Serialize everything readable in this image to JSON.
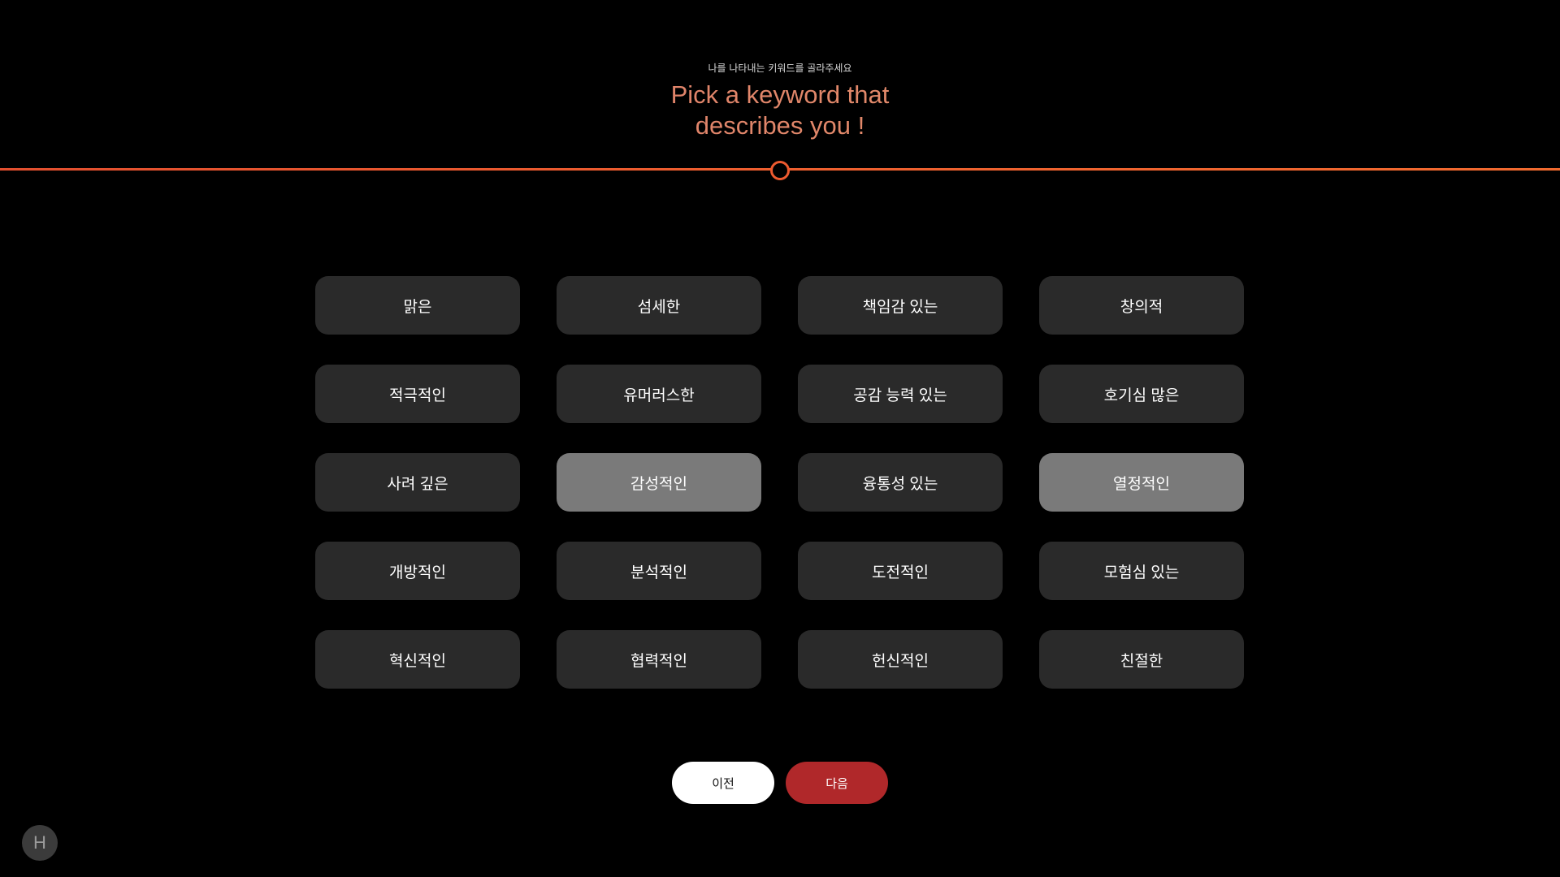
{
  "header": {
    "subtitle": "나를 나타내는 키워드를 골라주세요",
    "title_line1": "Pick a keyword that",
    "title_line2": "describes you !"
  },
  "keywords": [
    {
      "label": "맑은",
      "selected": false
    },
    {
      "label": "섬세한",
      "selected": false
    },
    {
      "label": "책임감 있는",
      "selected": false
    },
    {
      "label": "창의적",
      "selected": false
    },
    {
      "label": "적극적인",
      "selected": false
    },
    {
      "label": "유머러스한",
      "selected": false
    },
    {
      "label": "공감 능력 있는",
      "selected": false
    },
    {
      "label": "호기심 많은",
      "selected": false
    },
    {
      "label": "사려 깊은",
      "selected": false
    },
    {
      "label": "감성적인",
      "selected": true
    },
    {
      "label": "융통성 있는",
      "selected": false
    },
    {
      "label": "열정적인",
      "selected": true
    },
    {
      "label": "개방적인",
      "selected": false
    },
    {
      "label": "분석적인",
      "selected": false
    },
    {
      "label": "도전적인",
      "selected": false
    },
    {
      "label": "모험심 있는",
      "selected": false
    },
    {
      "label": "혁신적인",
      "selected": false
    },
    {
      "label": "협력적인",
      "selected": false
    },
    {
      "label": "헌신적인",
      "selected": false
    },
    {
      "label": "친절한",
      "selected": false
    }
  ],
  "nav": {
    "prev_label": "이전",
    "next_label": "다음"
  },
  "help_badge": {
    "label": "H"
  },
  "colors": {
    "accent": "#ee5a2f",
    "next_button": "#b0282a",
    "keyword_bg": "#2a2a2a",
    "keyword_selected_bg": "#7a7a7a"
  }
}
